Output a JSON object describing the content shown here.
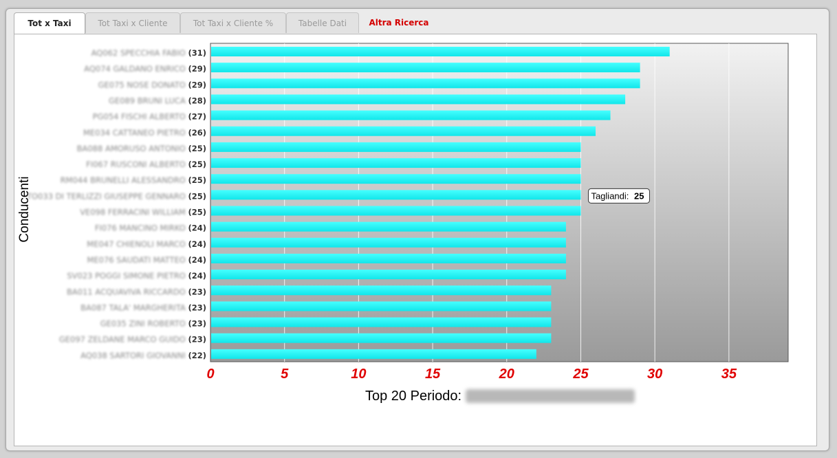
{
  "tabs": [
    {
      "label": "Tot x Taxi",
      "active": true
    },
    {
      "label": "Tot Taxi x Cliente",
      "active": false
    },
    {
      "label": "Tot Taxi x Cliente %",
      "active": false
    },
    {
      "label": "Tabelle Dati",
      "active": false
    },
    {
      "label": "Altra Ricerca",
      "active": false,
      "link": true
    }
  ],
  "colors": {
    "bar": "#22f5f5",
    "tick_label": "#e00000",
    "link_tab": "#d40000"
  },
  "chart_data": {
    "type": "bar",
    "orientation": "horizontal",
    "ylabel": "Conducenti",
    "xlabel": "Top 20 Periodo:",
    "xlim": [
      0,
      39
    ],
    "xticks": [
      0,
      5,
      10,
      15,
      20,
      25,
      30,
      35
    ],
    "grid": true,
    "categories": [
      "AQ062 SPECCHIA FABIO",
      "AQ074 GALDANO ENRICO",
      "GE075 NOSE DONATO",
      "GE089 BRUNI LUCA",
      "PG054 FISCHI ALBERTO",
      "ME034 CATTANEO PIETRO",
      "BA088 AMORUSO ANTONIO",
      "FI067 RUSCONI ALBERTO",
      "RM044 BRUNELLI ALESSANDRO",
      "TO033 DI TERLIZZI GIUSEPPE GENNARO",
      "VE098 FERRACINI WILLIAM",
      "FI076 MANCINO MIRKO",
      "ME047 CHIENOLI MARCO",
      "ME076 SAUDATI MATTEO",
      "SV023 POGGI SIMONE PIETRO",
      "BA011 ACQUAVIVA RICCARDO",
      "BA087 TALA' MARGHERITA",
      "GE035 ZINI ROBERTO",
      "GE097 ZELDANE MARCO GUIDO",
      "AQ038 SARTORI GIOVANNI"
    ],
    "value_labels": [
      "(31)",
      "(29)",
      "(29)",
      "(28)",
      "(27)",
      "(26)",
      "(25)",
      "(25)",
      "(25)",
      "(25)",
      "(25)",
      "(24)",
      "(24)",
      "(24)",
      "(24)",
      "(23)",
      "(23)",
      "(23)",
      "(23)",
      "(22)"
    ],
    "values": [
      31,
      29,
      29,
      28,
      27,
      26,
      25,
      25,
      25,
      25,
      25,
      24,
      24,
      24,
      24,
      23,
      23,
      23,
      23,
      22
    ],
    "tooltip": {
      "label": "Tagliandi:",
      "value": "25",
      "category_index": 9
    }
  }
}
